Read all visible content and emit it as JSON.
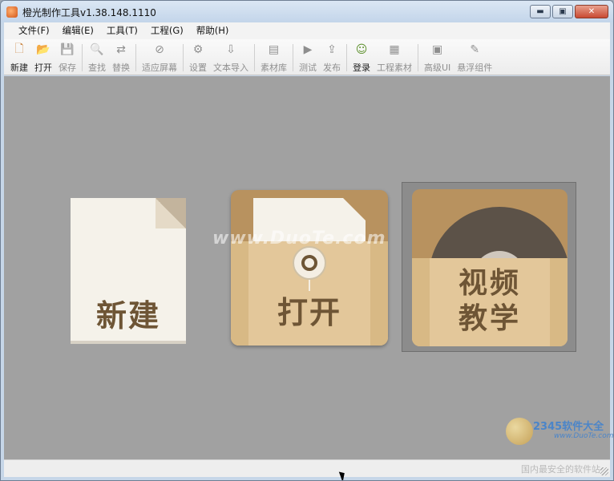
{
  "window": {
    "title": "橙光制作工具v1.38.148.1110"
  },
  "window_controls": {
    "minimize": "▬",
    "maximize": "▣",
    "close": "✕"
  },
  "menu": [
    {
      "label": "文件(F)"
    },
    {
      "label": "编辑(E)"
    },
    {
      "label": "工具(T)"
    },
    {
      "label": "工程(G)"
    },
    {
      "label": "帮助(H)"
    }
  ],
  "toolbar": [
    {
      "label": "新建",
      "icon": "new-file-icon",
      "glyph": "🗋",
      "enabled": true
    },
    {
      "label": "打开",
      "icon": "open-folder-icon",
      "glyph": "📂",
      "enabled": true
    },
    {
      "label": "保存",
      "icon": "save-icon",
      "glyph": "💾",
      "enabled": false
    },
    {
      "label": "查找",
      "icon": "find-icon",
      "glyph": "🔍",
      "enabled": false
    },
    {
      "label": "替换",
      "icon": "replace-icon",
      "glyph": "⇄",
      "enabled": false
    },
    {
      "label": "适应屏幕",
      "icon": "fit-screen-icon",
      "glyph": "⊘",
      "enabled": false
    },
    {
      "label": "设置",
      "icon": "gear-icon",
      "glyph": "⚙",
      "enabled": false
    },
    {
      "label": "文本导入",
      "icon": "text-import-icon",
      "glyph": "⇩",
      "enabled": false
    },
    {
      "label": "素材库",
      "icon": "asset-library-icon",
      "glyph": "▤",
      "enabled": false
    },
    {
      "label": "测试",
      "icon": "test-icon",
      "glyph": "▶",
      "enabled": false
    },
    {
      "label": "发布",
      "icon": "publish-icon",
      "glyph": "⇪",
      "enabled": false
    },
    {
      "label": "登录",
      "icon": "login-icon",
      "glyph": "☺",
      "enabled": true
    },
    {
      "label": "工程素材",
      "icon": "project-assets-icon",
      "glyph": "▦",
      "enabled": false
    },
    {
      "label": "高级UI",
      "icon": "advanced-ui-icon",
      "glyph": "▣",
      "enabled": false
    },
    {
      "label": "悬浮组件",
      "icon": "floating-widget-icon",
      "glyph": "✎",
      "enabled": false
    }
  ],
  "cards": {
    "new": {
      "label": "新建"
    },
    "open": {
      "label": "打开"
    },
    "video": {
      "line1": "视频",
      "line2": "教学"
    }
  },
  "watermarks": {
    "center": "www.DuoTe.com",
    "logo_title": "2345软件大全",
    "logo_sub": "www.DuoTe.com",
    "status": "国内最安全的软件站"
  }
}
